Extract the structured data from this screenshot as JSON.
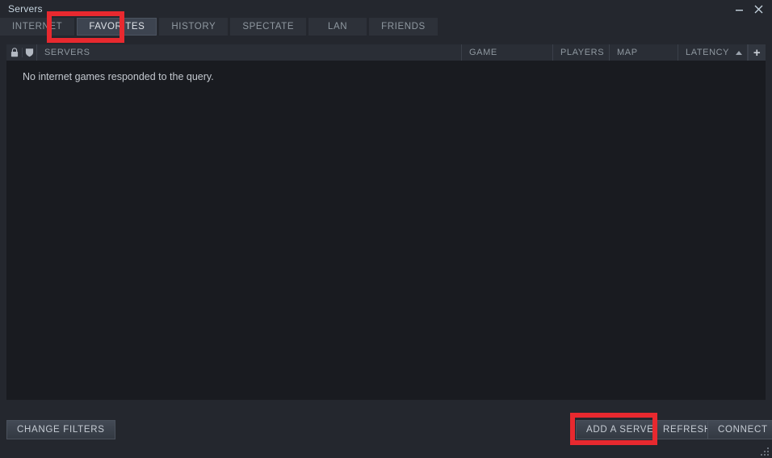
{
  "window": {
    "title": "Servers",
    "controls": [
      {
        "name": "minimize",
        "glyph": "–"
      },
      {
        "name": "close",
        "glyph": "✕"
      }
    ]
  },
  "tabs": [
    {
      "label": "INTERNET",
      "active": false
    },
    {
      "label": "FAVORITES",
      "active": true
    },
    {
      "label": "HISTORY",
      "active": false
    },
    {
      "label": "SPECTATE",
      "active": false
    },
    {
      "label": "LAN",
      "active": false
    },
    {
      "label": "FRIENDS",
      "active": false
    }
  ],
  "columns": {
    "lock_icon": "lock-icon",
    "shield_icon": "shield-icon",
    "servers": "SERVERS",
    "game": "GAME",
    "players": "PLAYERS",
    "map": "MAP",
    "latency": "LATENCY",
    "sort_direction": "ascending",
    "add_column": "+"
  },
  "list": {
    "rows": [],
    "empty_message": "No internet games responded to the query."
  },
  "buttons": {
    "change_filters": "CHANGE FILTERS",
    "add_a_server": "ADD A SERVER",
    "refresh": "REFRESH",
    "connect": "CONNECT"
  },
  "annotations": {
    "highlight_color": "#e8292f",
    "highlighted": [
      "FAVORITES",
      "ADD A SERVER"
    ]
  }
}
